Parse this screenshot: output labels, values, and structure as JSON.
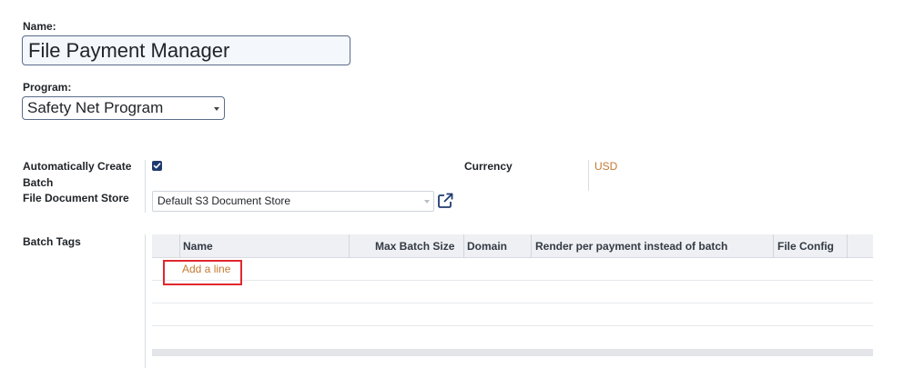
{
  "form": {
    "name_label": "Name:",
    "name_value": "File Payment Manager",
    "program_label": "Program:",
    "program_value": "Safety Net Program",
    "auto_create_label_line1": "Automatically Create",
    "auto_create_label_line2": "Batch",
    "auto_create_checked": true,
    "currency_label": "Currency",
    "currency_value": "USD",
    "file_store_label": "File Document Store",
    "file_store_value": "Default S3 Document Store",
    "batch_tags_label": "Batch Tags"
  },
  "table": {
    "columns": [
      "Name",
      "Max Batch Size",
      "Domain",
      "Render per payment instead of batch",
      "File Config"
    ],
    "add_line_label": "Add a line"
  },
  "colors": {
    "accent_link": "#c47a34",
    "checkbox": "#1f3b6e",
    "highlight_box": "#e0282e"
  }
}
